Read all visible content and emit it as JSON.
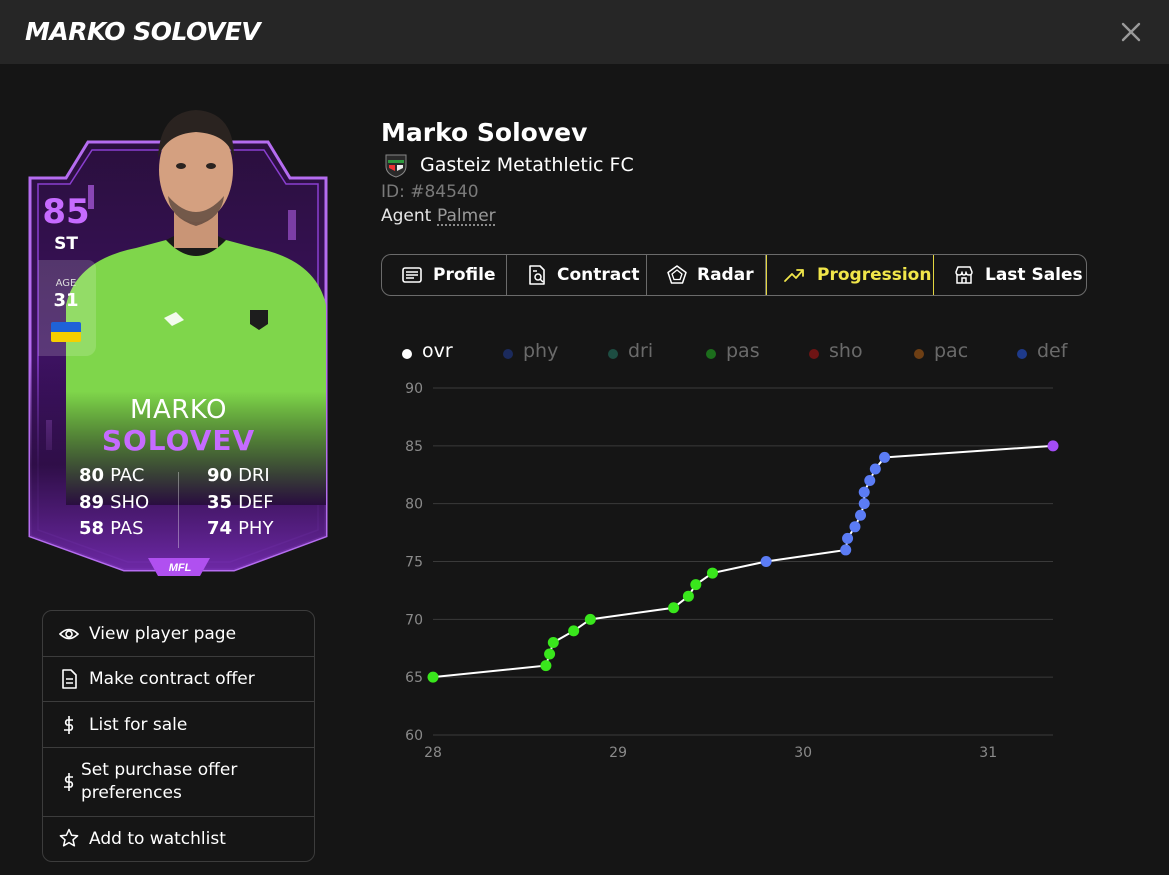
{
  "modal": {
    "title": "MARKO SOLOVEV",
    "close_icon": "close-icon"
  },
  "card": {
    "overall": "85",
    "position": "ST",
    "age_label": "AGE",
    "age": "31",
    "nationality_flag": "ukraine-flag-icon",
    "first_name": "MARKO",
    "last_name": "SOLOVEV",
    "accent_color": "#c66bff",
    "stats_left": [
      {
        "value": "80",
        "label": "PAC"
      },
      {
        "value": "89",
        "label": "SHO"
      },
      {
        "value": "58",
        "label": "PAS"
      }
    ],
    "stats_right": [
      {
        "value": "90",
        "label": "DRI"
      },
      {
        "value": "35",
        "label": "DEF"
      },
      {
        "value": "74",
        "label": "PHY"
      }
    ],
    "logo": "MFL"
  },
  "actions": [
    {
      "label": "View player page",
      "icon": "eye-icon"
    },
    {
      "label": "Make contract offer",
      "icon": "document-icon"
    },
    {
      "label": "List for sale",
      "icon": "dollar-icon"
    },
    {
      "label": "Set purchase offer preferences",
      "icon": "dollar-icon"
    },
    {
      "label": "Add to watchlist",
      "icon": "star-icon"
    }
  ],
  "player": {
    "name": "Marko Solovev",
    "club": "Gasteiz Metathletic FC",
    "id": "ID: #84540",
    "agent_label": "Agent",
    "agent_name": "Palmer"
  },
  "tabs": [
    {
      "label": "Profile",
      "icon": "profile-icon",
      "active": false
    },
    {
      "label": "Contract",
      "icon": "contract-icon",
      "active": false
    },
    {
      "label": "Radar",
      "icon": "radar-icon",
      "active": false
    },
    {
      "label": "Progression",
      "icon": "trending-up-icon",
      "active": true
    },
    {
      "label": "Last Sales",
      "icon": "store-icon",
      "active": false
    }
  ],
  "active_tab_color": "#f1e64a",
  "chart_data": {
    "type": "line",
    "legend": [
      {
        "name": "ovr",
        "color": "#ffffff",
        "active": true
      },
      {
        "name": "phy",
        "color": "#1b2a5c",
        "active": false
      },
      {
        "name": "dri",
        "color": "#1d4d42",
        "active": false
      },
      {
        "name": "pas",
        "color": "#1c6e1c",
        "active": false
      },
      {
        "name": "sho",
        "color": "#6e1414",
        "active": false
      },
      {
        "name": "pac",
        "color": "#6e3f14",
        "active": false
      },
      {
        "name": "def",
        "color": "#1e3a8a",
        "active": false
      }
    ],
    "x_ticks": [
      "28",
      "29",
      "30",
      "31"
    ],
    "y_ticks": [
      "90",
      "85",
      "80",
      "75",
      "70",
      "65",
      "60"
    ],
    "xlim": [
      28,
      31.35
    ],
    "ylim": [
      60,
      90
    ],
    "grid": true,
    "series": [
      {
        "name": "ovr",
        "line_color": "#ffffff",
        "points": [
          {
            "x": 28.0,
            "y": 65,
            "color": "#39e61c"
          },
          {
            "x": 28.61,
            "y": 66,
            "color": "#39e61c"
          },
          {
            "x": 28.63,
            "y": 67,
            "color": "#39e61c"
          },
          {
            "x": 28.65,
            "y": 68,
            "color": "#39e61c"
          },
          {
            "x": 28.76,
            "y": 69,
            "color": "#39e61c"
          },
          {
            "x": 28.85,
            "y": 70,
            "color": "#39e61c"
          },
          {
            "x": 29.3,
            "y": 71,
            "color": "#39e61c"
          },
          {
            "x": 29.38,
            "y": 72,
            "color": "#39e61c"
          },
          {
            "x": 29.42,
            "y": 73,
            "color": "#39e61c"
          },
          {
            "x": 29.51,
            "y": 74,
            "color": "#39e61c"
          },
          {
            "x": 29.8,
            "y": 75,
            "color": "#5b7cf5"
          },
          {
            "x": 30.23,
            "y": 76,
            "color": "#5b7cf5"
          },
          {
            "x": 30.24,
            "y": 77,
            "color": "#5b7cf5"
          },
          {
            "x": 30.28,
            "y": 78,
            "color": "#5b7cf5"
          },
          {
            "x": 30.31,
            "y": 79,
            "color": "#5b7cf5"
          },
          {
            "x": 30.33,
            "y": 80,
            "color": "#5b7cf5"
          },
          {
            "x": 30.33,
            "y": 81,
            "color": "#5b7cf5"
          },
          {
            "x": 30.36,
            "y": 82,
            "color": "#5b7cf5"
          },
          {
            "x": 30.39,
            "y": 83,
            "color": "#5b7cf5"
          },
          {
            "x": 30.44,
            "y": 84,
            "color": "#5b7cf5"
          },
          {
            "x": 31.35,
            "y": 85,
            "color": "#a34cf5"
          }
        ]
      }
    ]
  }
}
